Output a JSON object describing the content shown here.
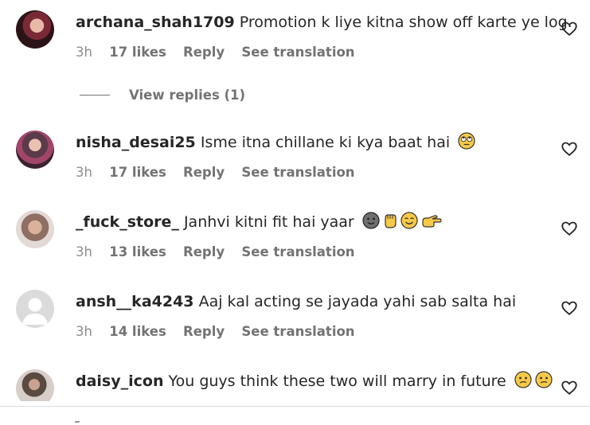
{
  "comments": [
    {
      "username": "archana_shah1709",
      "text": "Promotion k liye kitna show off karte ye log.",
      "time": "3h",
      "likes": "17 likes",
      "reply": "Reply",
      "translate": "See translation",
      "emojis": []
    },
    {
      "username": "nisha_desai25",
      "text": "Isme itna chillane ki kya baat hai",
      "time": "3h",
      "likes": "17 likes",
      "reply": "Reply",
      "translate": "See translation",
      "emojis": [
        "face-with-rolling-eyes"
      ]
    },
    {
      "username": "_fuck_store_",
      "text": "Janhvi kitni fit hai yaar",
      "time": "3h",
      "likes": "13 likes",
      "reply": "Reply",
      "translate": "See translation",
      "emojis": [
        "dark-smiley",
        "raised-fist",
        "smiling-face",
        "pointing-hand"
      ]
    },
    {
      "username": "ansh__ka4243",
      "text": "Aaj kal acting se jayada yahi sab salta hai",
      "time": "3h",
      "likes": "14 likes",
      "reply": "Reply",
      "translate": "See translation",
      "emojis": []
    },
    {
      "username": "daisy_icon",
      "text": "You guys think these two will marry in future",
      "emojis": [
        "confused-face",
        "confused-face"
      ]
    }
  ],
  "view_replies": "View replies (1)",
  "colors": {
    "text": "#262626",
    "secondary": "#737373",
    "divider": "#dbdbdb",
    "emoji": "#f7c948"
  }
}
